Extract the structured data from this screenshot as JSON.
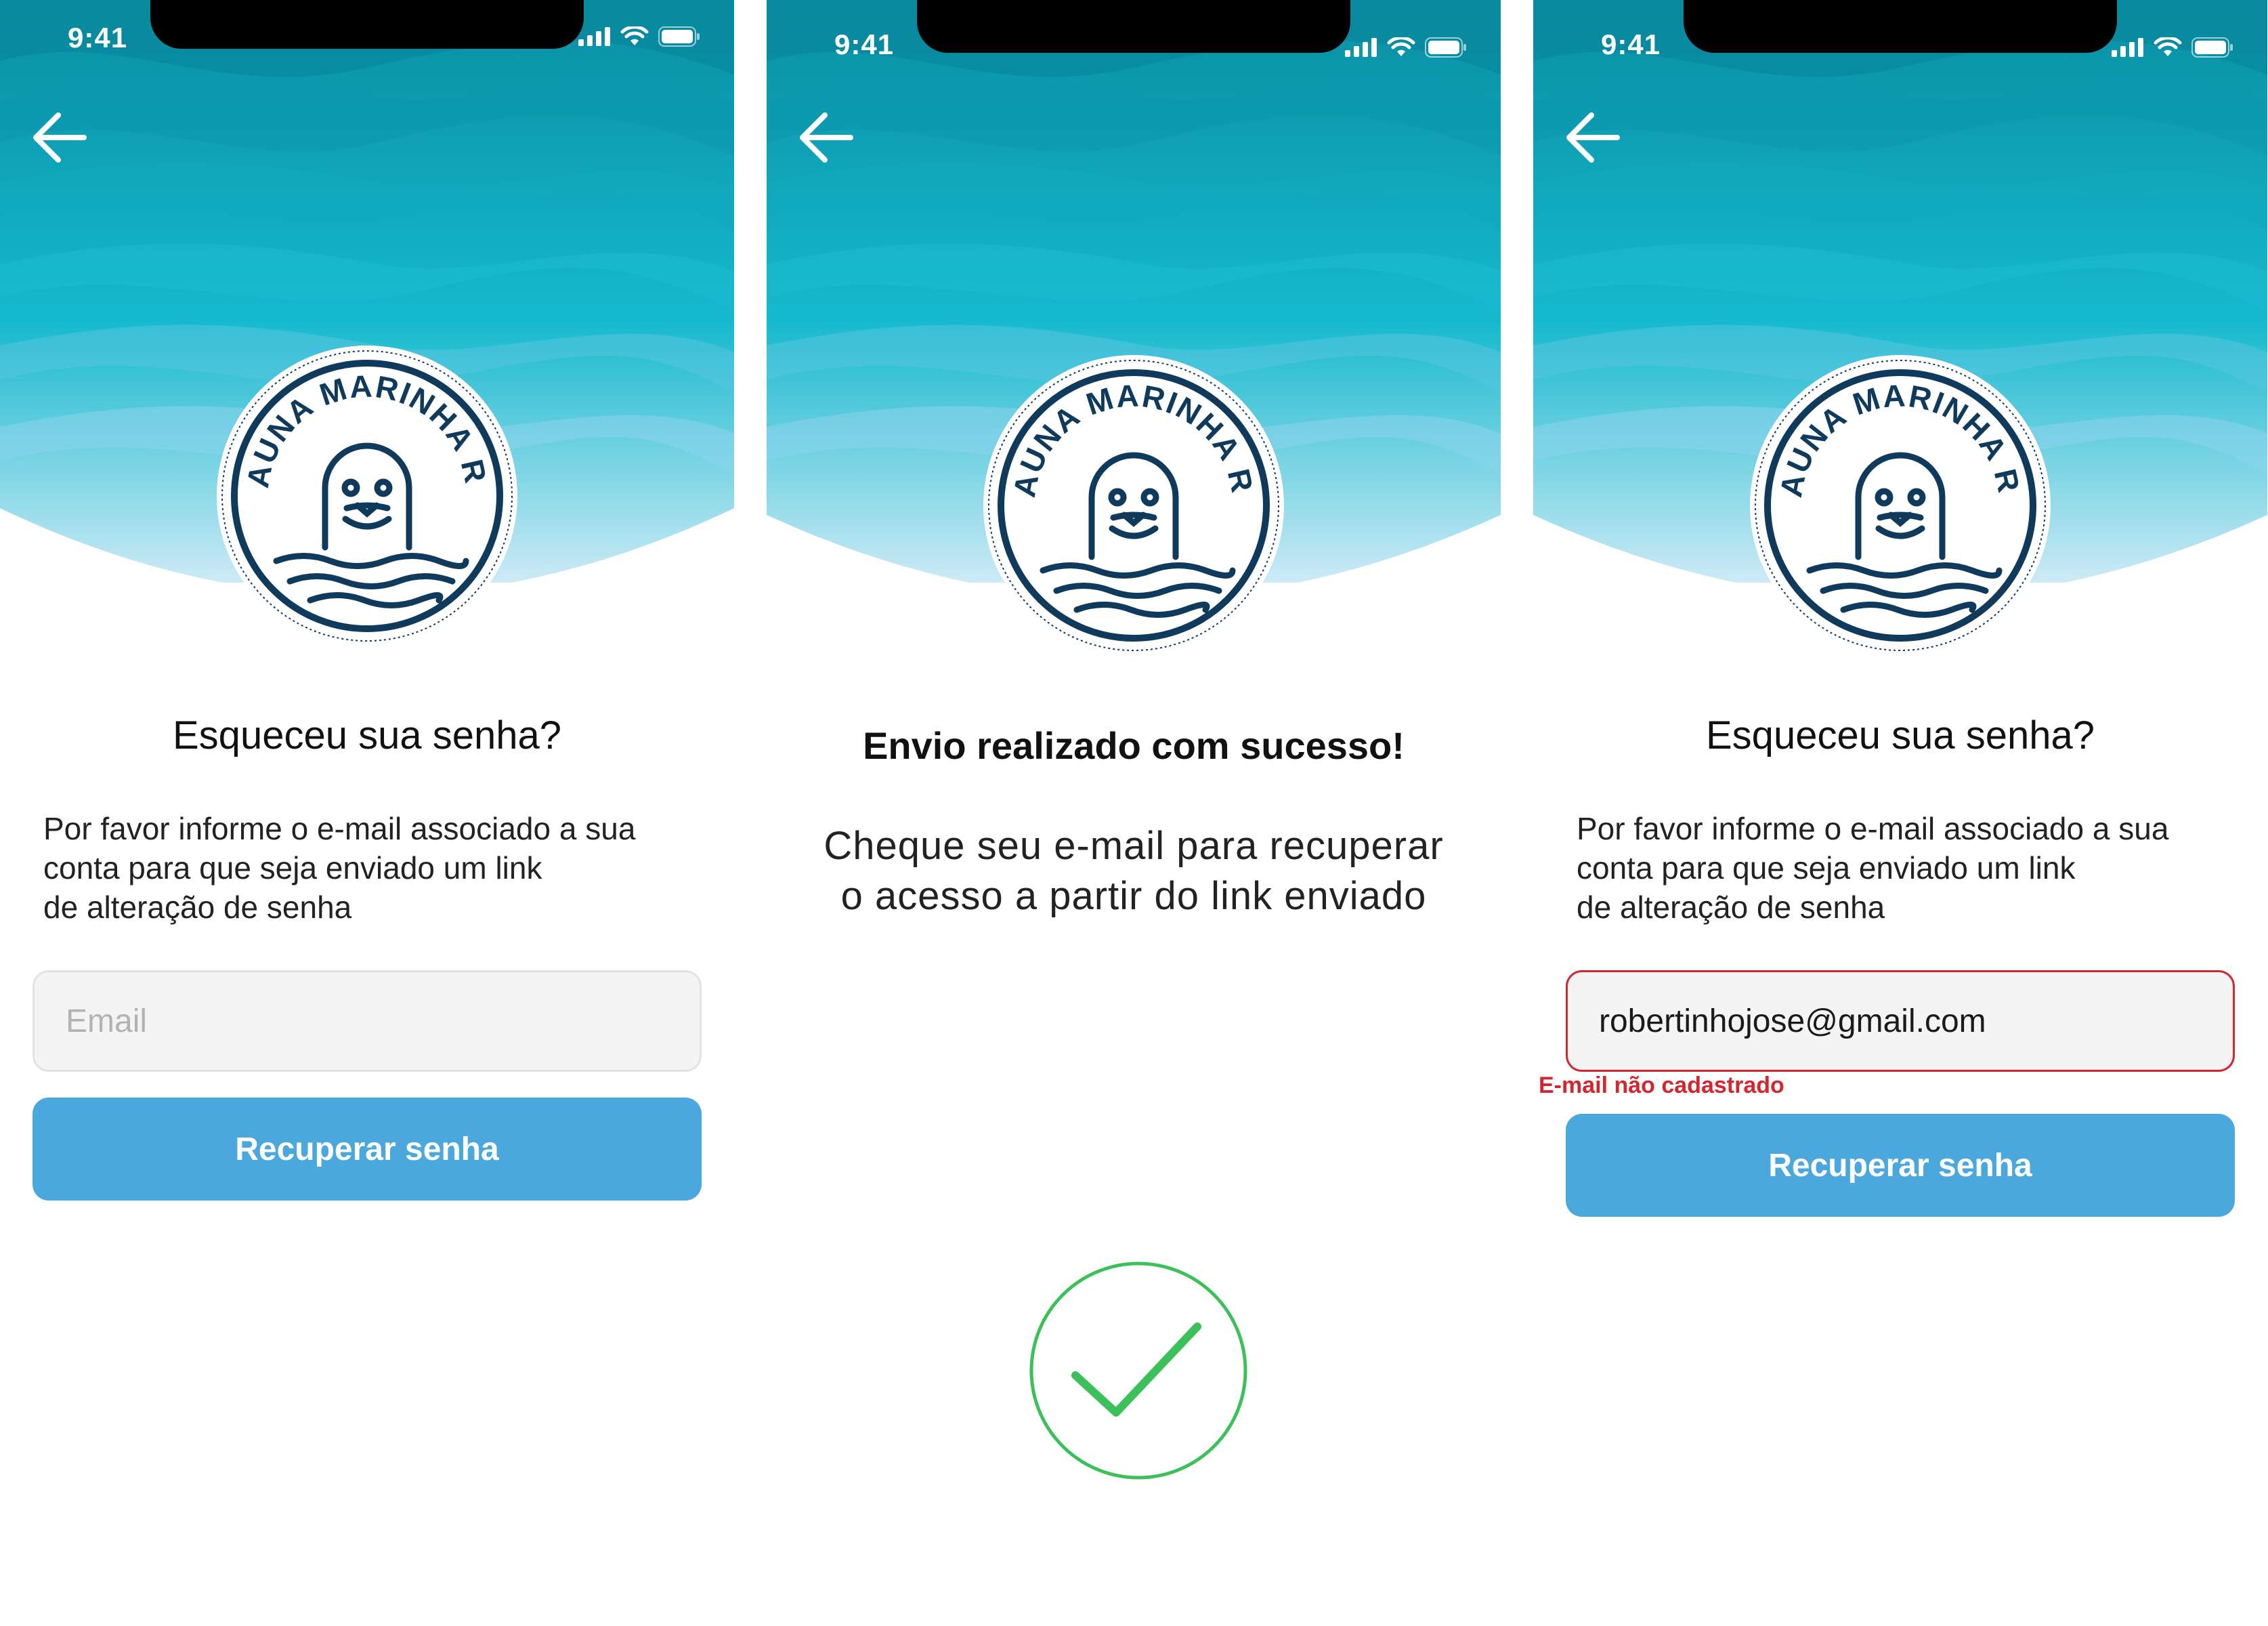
{
  "status_bar": {
    "time": "9:41"
  },
  "logo": {
    "text": "FAUNA MARINHA RS"
  },
  "screens": [
    {
      "title": "Esqueceu sua senha?",
      "description": [
        "Por favor informe o e-mail associado a sua",
        "conta para que seja enviado um link",
        "de alteração  de senha"
      ],
      "email_input": {
        "placeholder": "Email",
        "value": ""
      },
      "button_label": "Recuperar senha"
    },
    {
      "title": "Envio realizado com sucesso!",
      "description": [
        "Cheque seu e-mail para recuperar",
        "o acesso  a partir do link enviado"
      ],
      "icon": "check-circle-icon"
    },
    {
      "title": "Esqueceu sua senha?",
      "description": [
        "Por favor informe o e-mail associado a sua",
        "conta para que seja enviado um link",
        "de alteração  de senha"
      ],
      "email_input": {
        "placeholder": "Email",
        "value": "robertinhojose@gmail.com"
      },
      "error_message": "E-mail não cadastrado",
      "button_label": "Recuperar senha"
    }
  ],
  "colors": {
    "ocean_dark": "#0a8ea3",
    "ocean_mid": "#14b8cc",
    "ocean_light": "#bfe6f4",
    "logo_navy": "#0f3a5c",
    "button_blue": "#4aa8dd",
    "error_red": "#d4262e",
    "success_green": "#3cc05a"
  }
}
